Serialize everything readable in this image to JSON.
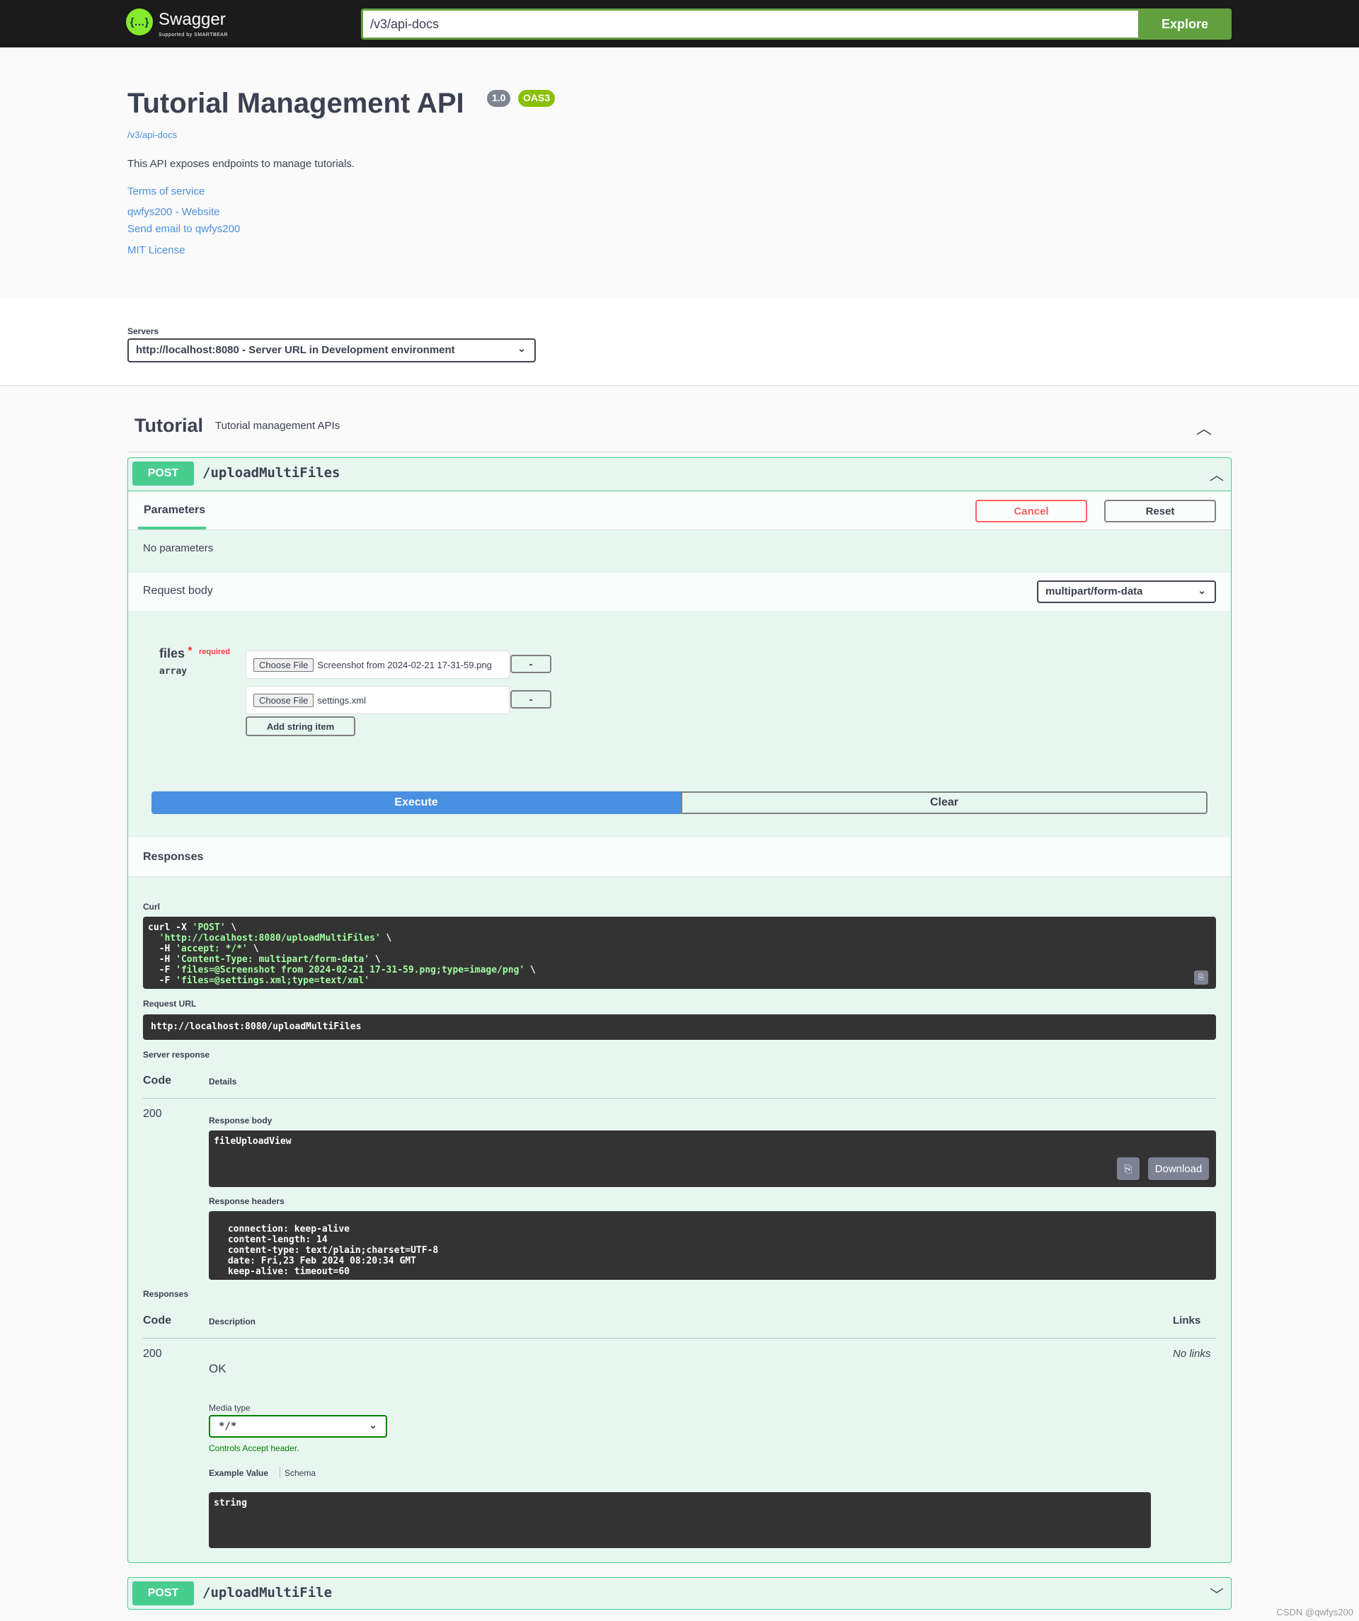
{
  "topbar": {
    "logo_text": "Swagger",
    "logo_sub": "Supported by SMARTBEAR",
    "logo_glyph": "{…}",
    "url_value": "/v3/api-docs",
    "explore_label": "Explore"
  },
  "info": {
    "title": "Tutorial Management API",
    "version": "1.0",
    "oas": "OAS3",
    "docs_link": "/v3/api-docs",
    "description": "This API exposes endpoints to manage tutorials.",
    "links": [
      "Terms of service",
      "qwfys200 - Website",
      "Send email to qwfys200",
      "MIT License"
    ]
  },
  "servers": {
    "label": "Servers",
    "selected": "http://localhost:8080 - Server URL in Development environment"
  },
  "tag": {
    "name": "Tutorial",
    "description": "Tutorial management APIs"
  },
  "operations": [
    {
      "method": "POST",
      "path": "/uploadMultiFiles",
      "params_tab": "Parameters",
      "cancel_label": "Cancel",
      "reset_label": "Reset",
      "no_params": "No parameters",
      "request_body_label": "Request body",
      "content_type": "multipart/form-data",
      "field": {
        "name": "files",
        "required_mark": "*",
        "required_label": "required",
        "type": "array",
        "items": [
          {
            "button": "Choose File",
            "file": "Screenshot from 2024-02-21 17-31-59.png",
            "remove": "-"
          },
          {
            "button": "Choose File",
            "file": "settings.xml",
            "remove": "-"
          }
        ],
        "add_label": "Add string item"
      },
      "execute_label": "Execute",
      "clear_label": "Clear",
      "responses_label": "Responses",
      "curl_label": "Curl",
      "curl": {
        "l1a": "curl -X ",
        "l1b": "'POST'",
        "l1c": " \\",
        "l2": "'http://localhost:8080/uploadMultiFiles'",
        "l3a": "-H ",
        "l3b": "'accept: */*'",
        "l4a": "-H ",
        "l4b": "'Content-Type: multipart/form-data'",
        "l5a": "-F ",
        "l5b": "'files=@Screenshot from 2024-02-21 17-31-59.png;type=image/png'",
        "l6a": "-F ",
        "l6b": "'files=@settings.xml;type=text/xml'"
      },
      "request_url_label": "Request URL",
      "request_url": "http://localhost:8080/uploadMultiFiles",
      "server_response_label": "Server response",
      "code_header": "Code",
      "details_header": "Details",
      "server_code": "200",
      "response_body_label": "Response body",
      "response_body": "fileUploadView",
      "download_label": "Download",
      "response_headers_label": "Response headers",
      "response_headers": " connection: keep-alive \n content-length: 14 \n content-type: text/plain;charset=UTF-8 \n date: Fri,23 Feb 2024 08:20:34 GMT \n keep-alive: timeout=60 ",
      "responses_section_label": "Responses",
      "description_header": "Description",
      "links_header": "Links",
      "doc_code": "200",
      "doc_description": "OK",
      "doc_links": "No links",
      "media_type_label": "Media type",
      "media_type": "*/*",
      "accept_note": "Controls Accept header.",
      "example_tab": "Example Value",
      "schema_tab": "Schema",
      "example_value": "string"
    },
    {
      "method": "POST",
      "path": "/uploadMultiFile"
    }
  ],
  "watermark": "CSDN @qwfys200",
  "colors": {
    "post": "#49cc90",
    "execute": "#4990e2",
    "explore": "#62a03f",
    "cancel": "#ff6060",
    "link": "#4990e2"
  }
}
